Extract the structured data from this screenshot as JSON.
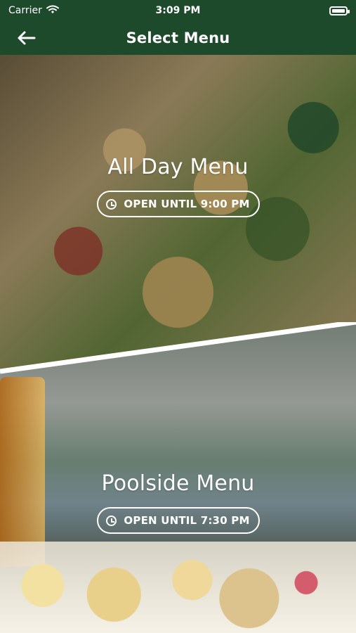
{
  "status": {
    "carrier": "Carrier",
    "time": "3:09 PM",
    "wifi_icon": "wifi-icon",
    "battery_icon": "battery-icon"
  },
  "nav": {
    "title": "Select Menu",
    "back_icon": "back-arrow-icon"
  },
  "menus": [
    {
      "title": "All Day Menu",
      "status": "OPEN UNTIL 9:00 PM"
    },
    {
      "title": "Poolside Menu",
      "status": "OPEN UNTIL 7:30 PM"
    }
  ],
  "colors": {
    "header": "#1d4a2a",
    "text": "#ffffff"
  }
}
